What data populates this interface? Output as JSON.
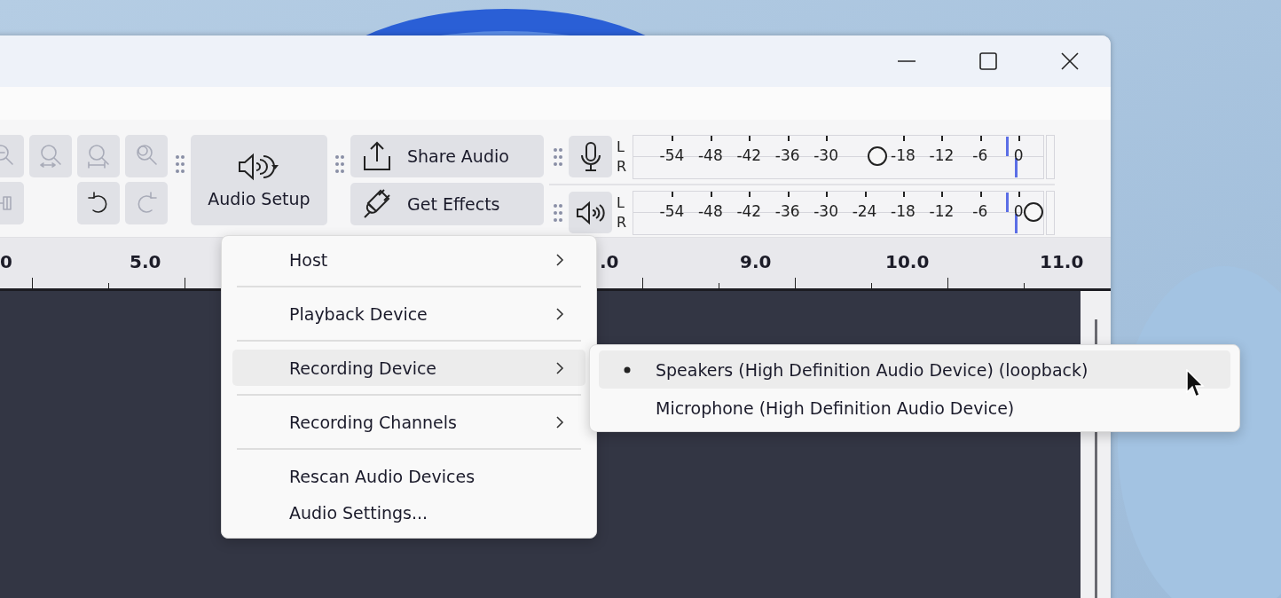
{
  "edit_toolbar": {
    "buttons": [
      {
        "kind": "zoom-out",
        "disabled": true
      },
      {
        "kind": "zoom-fit-selection",
        "disabled": true
      },
      {
        "kind": "zoom-fit",
        "disabled": true
      },
      {
        "kind": "zoom-toggle",
        "disabled": true
      },
      {
        "kind": "silence",
        "disabled": true
      },
      {
        "kind": "blank"
      },
      {
        "kind": "undo",
        "disabled": false
      },
      {
        "kind": "redo",
        "disabled": true
      }
    ]
  },
  "audio_setup": {
    "label": "Audio Setup"
  },
  "share_audio": {
    "label": "Share Audio"
  },
  "get_effects": {
    "label": "Get Effects"
  },
  "meters": [
    {
      "kind": "recording",
      "channels": [
        {
          "label": "L",
          "level": 0.91
        },
        {
          "label": "R",
          "level": 0.93
        }
      ],
      "ticks": [
        "-54",
        "-48",
        "-42",
        "-36",
        "-30",
        "-18",
        "-12",
        "-6",
        "0"
      ],
      "slider": {
        "level": 0.6
      }
    },
    {
      "kind": "playback",
      "channels": [
        {
          "label": "L",
          "level": 0.91
        },
        {
          "label": "R",
          "level": 0.93
        }
      ],
      "ticks": [
        "-54",
        "-48",
        "-42",
        "-36",
        "-30",
        "-24",
        "-18",
        "-12",
        "-6",
        "0"
      ],
      "slider": {
        "level": 1.0
      }
    }
  ],
  "ruler": {
    "labels": [
      "0",
      "5.0",
      ".0",
      "9.0",
      "10.0",
      "11.0"
    ]
  },
  "menu": {
    "groups": [
      [
        {
          "label": "Host",
          "submenu": true,
          "selected": false
        }
      ],
      [
        {
          "label": "Playback Device",
          "submenu": true,
          "selected": false
        }
      ],
      [
        {
          "label": "Recording Device",
          "submenu": true,
          "selected": true
        }
      ],
      [
        {
          "label": "Recording Channels",
          "submenu": true,
          "selected": false
        }
      ],
      [
        {
          "label": "Rescan Audio Devices",
          "submenu": false,
          "selected": false
        },
        {
          "label": "Audio Settings...",
          "submenu": false,
          "selected": false
        }
      ]
    ]
  },
  "submenu": {
    "items": [
      {
        "label": "Speakers (High Definition Audio Device) (loopback)",
        "checked": true,
        "selected": true
      },
      {
        "label": "Microphone (High Definition Audio Device)",
        "checked": false,
        "selected": false
      }
    ]
  }
}
